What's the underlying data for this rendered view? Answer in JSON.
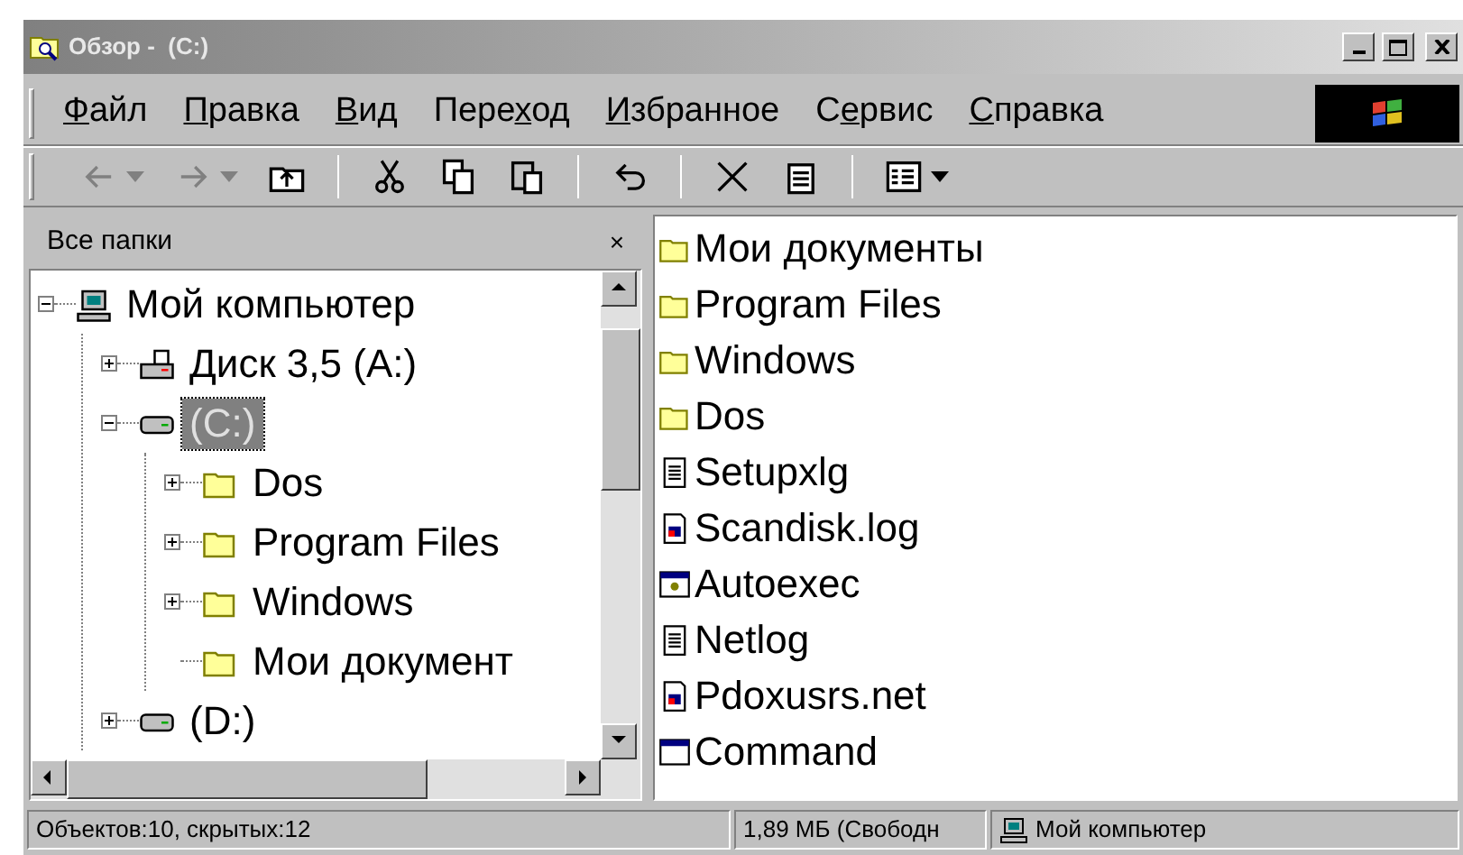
{
  "window": {
    "title": "Обзор -  (C:)"
  },
  "menu": [
    {
      "key": "Ф",
      "after": "айл"
    },
    {
      "key": "П",
      "after": "равка"
    },
    {
      "key": "В",
      "after": "ид"
    },
    {
      "before": "Пере",
      "key": "х",
      "after": "од"
    },
    {
      "key": "И",
      "after": "збранное"
    },
    {
      "before": "С",
      "key": "е",
      "after": "рвис"
    },
    {
      "key": "С",
      "after": "правка"
    }
  ],
  "toolbar": [
    {
      "kind": "back",
      "disabled": true
    },
    {
      "kind": "forward",
      "disabled": true
    },
    {
      "kind": "up",
      "disabled": false
    },
    {
      "kind": "sep"
    },
    {
      "kind": "cut",
      "disabled": false
    },
    {
      "kind": "copy",
      "disabled": false
    },
    {
      "kind": "paste",
      "disabled": false
    },
    {
      "kind": "sep"
    },
    {
      "kind": "undo",
      "disabled": false
    },
    {
      "kind": "sep"
    },
    {
      "kind": "delete",
      "disabled": false
    },
    {
      "kind": "properties",
      "disabled": false
    },
    {
      "kind": "sep"
    },
    {
      "kind": "views",
      "disabled": false
    }
  ],
  "folders_pane": {
    "title": "Все папки",
    "close": "×",
    "tree": [
      {
        "label": "Мой компьютер",
        "kind": "computer",
        "expanded": true,
        "selected": false,
        "children": [
          {
            "label": "Диск 3,5 (A:)",
            "kind": "floppy",
            "expanded": false,
            "selected": false
          },
          {
            "label": "(C:)",
            "kind": "drive",
            "expanded": true,
            "selected": true,
            "children": [
              {
                "label": "Dos",
                "kind": "folder",
                "expanded": false,
                "selected": false
              },
              {
                "label": "Program Files",
                "kind": "folder",
                "expanded": false,
                "selected": false
              },
              {
                "label": "Windows",
                "kind": "folder",
                "expanded": false,
                "selected": false
              },
              {
                "label": "Мои документ",
                "kind": "folder",
                "selected": false
              }
            ]
          },
          {
            "label": "(D:)",
            "kind": "drive",
            "expanded": false,
            "selected": false
          }
        ]
      }
    ]
  },
  "files": [
    {
      "name": "Мои документы",
      "kind": "folder"
    },
    {
      "name": "Program Files",
      "kind": "folder"
    },
    {
      "name": "Windows",
      "kind": "folder"
    },
    {
      "name": "Dos",
      "kind": "folder"
    },
    {
      "name": "Setupxlg",
      "kind": "text"
    },
    {
      "name": "Scandisk.log",
      "kind": "image"
    },
    {
      "name": "Autoexec",
      "kind": "app"
    },
    {
      "name": "Netlog",
      "kind": "text"
    },
    {
      "name": "Pdoxusrs.net",
      "kind": "image"
    },
    {
      "name": "Command",
      "kind": "dos"
    }
  ],
  "status_bar": {
    "objects": "Объектов:10, скрытых:12",
    "free": "1,89 МБ (Свободн",
    "location": "Мой компьютер"
  }
}
